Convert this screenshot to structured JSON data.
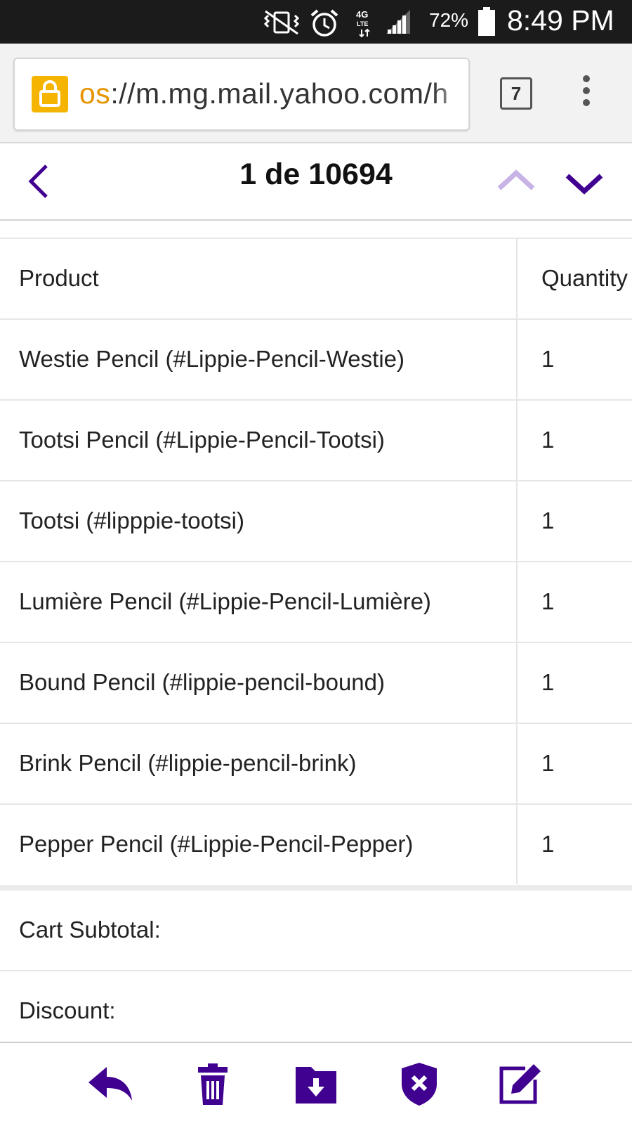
{
  "status_bar": {
    "battery_percent": "72%",
    "time": "8:49 PM",
    "icons": [
      "vibrate-icon",
      "alarm-icon",
      "4g-lte-icon",
      "signal-icon",
      "battery-icon"
    ]
  },
  "browser": {
    "url_scheme": "os",
    "url_rest": "://m.mg.mail.yahoo.com/h",
    "tab_count": "7",
    "icons": [
      "lock-icon",
      "tabs-icon",
      "menu-icon"
    ]
  },
  "message_nav": {
    "counter": "1 de 10694",
    "icons": [
      "back-icon",
      "previous-icon",
      "next-icon"
    ]
  },
  "table": {
    "headers": {
      "product": "Product",
      "quantity": "Quantity"
    },
    "rows": [
      {
        "product": "Westie Pencil (#Lippie-Pencil-Westie)",
        "quantity": "1"
      },
      {
        "product": "Tootsi Pencil (#Lippie-Pencil-Tootsi)",
        "quantity": "1"
      },
      {
        "product": "Tootsi (#lipppie-tootsi)",
        "quantity": "1"
      },
      {
        "product": "Lumière Pencil (#Lippie-Pencil-Lumière)",
        "quantity": "1"
      },
      {
        "product": "Bound Pencil (#lippie-pencil-bound)",
        "quantity": "1"
      },
      {
        "product": "Brink Pencil (#lippie-pencil-brink)",
        "quantity": "1"
      },
      {
        "product": "Pepper Pencil (#Lippie-Pencil-Pepper)",
        "quantity": "1"
      }
    ]
  },
  "totals": {
    "subtotal_label": "Cart Subtotal:",
    "discount_label": "Discount:"
  },
  "toolbar": {
    "icons": [
      "reply-icon",
      "delete-icon",
      "move-icon",
      "spam-icon",
      "compose-icon"
    ]
  },
  "colors": {
    "accent": "#400090",
    "accent_light": "#c7b3e6",
    "lock": "#f4b400"
  }
}
